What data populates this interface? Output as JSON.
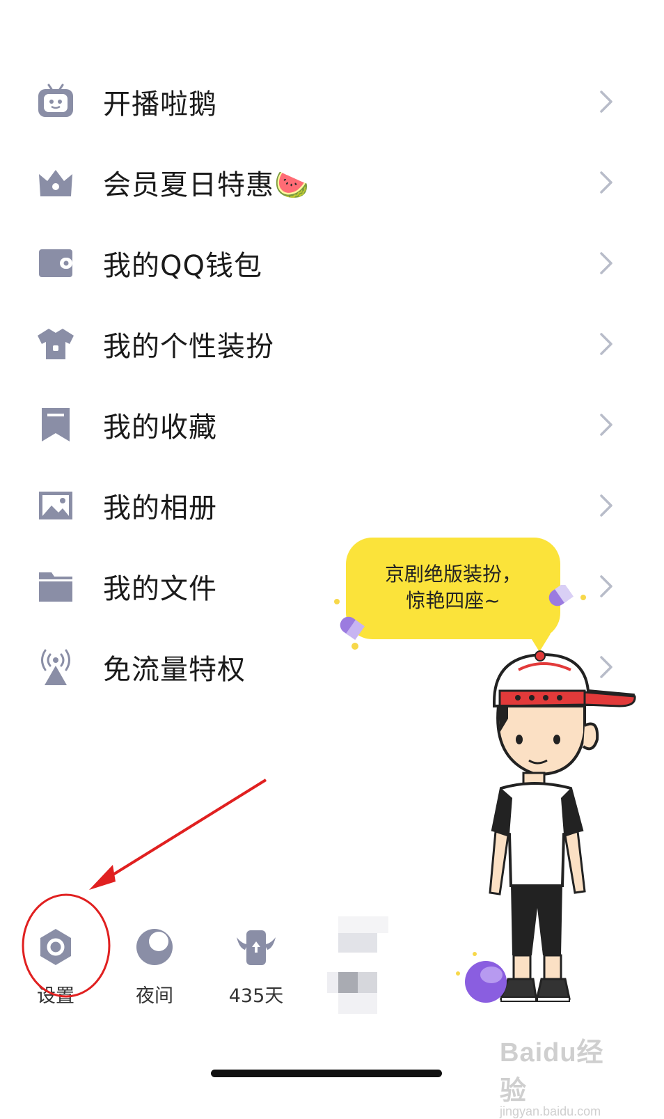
{
  "menu": {
    "items": [
      {
        "label": "开播啦鹅",
        "icon": "live-tv-icon"
      },
      {
        "label": "会员夏日特惠🍉",
        "icon": "crown-icon"
      },
      {
        "label": "我的QQ钱包",
        "icon": "wallet-icon"
      },
      {
        "label": "我的个性装扮",
        "icon": "tshirt-icon"
      },
      {
        "label": "我的收藏",
        "icon": "bookmark-icon"
      },
      {
        "label": "我的相册",
        "icon": "photo-icon"
      },
      {
        "label": "我的文件",
        "icon": "folder-icon"
      },
      {
        "label": "免流量特权",
        "icon": "signal-tower-icon"
      }
    ]
  },
  "bubble": {
    "line1": "京剧绝版装扮，",
    "line2": "惊艳四座~"
  },
  "bottom_bar": {
    "settings_label": "设置",
    "night_label": "夜间",
    "days_label": "435天"
  },
  "watermark": {
    "line1": "Baidu经验",
    "line2": "jingyan.baidu.com"
  },
  "colors": {
    "icon_gray": "#8a8ea6",
    "chevron": "#b8bcc9",
    "bubble_yellow": "#fbe33a",
    "annotation_red": "#e02020"
  }
}
